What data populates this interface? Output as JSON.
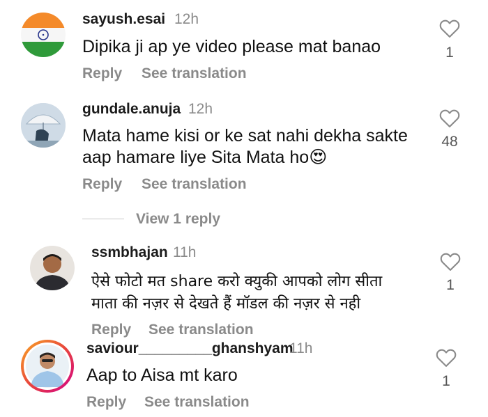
{
  "comments": [
    {
      "username": "sayush.esai",
      "time": "12h",
      "text": "Dipika ji ap ye video please mat banao",
      "likes": "1",
      "reply_label": "Reply",
      "translate_label": "See translation"
    },
    {
      "username": "gundale.anuja",
      "time": "12h",
      "text": "Mata hame kisi or ke sat nahi dekha sakte aap hamare liye Sita Mata ho",
      "emoji": "😍",
      "likes": "48",
      "reply_label": "Reply",
      "translate_label": "See translation",
      "view_replies_label": "View 1 reply"
    },
    {
      "username": "ssmbhajan",
      "time": "11h",
      "text_line1": "ऐसे फोटो मत share करो क्युकी आपको लोग सीता",
      "text_line2": "माता की नज़र से देखते हैं मॉडल की नज़र से नही",
      "likes": "1",
      "reply_label": "Reply",
      "translate_label": "See translation"
    },
    {
      "username": "saviour_________ghanshyam",
      "time": "11h",
      "text": "Aap to Aisa mt karo",
      "likes": "1",
      "reply_label": "Reply",
      "translate_label": "See translation"
    }
  ],
  "icons": {
    "like": "heart-outline-icon"
  },
  "colors": {
    "text": "#111111",
    "secondary": "#8a8a8a",
    "story_ring_start": "#f9a825",
    "story_ring_end": "#d3008a"
  }
}
